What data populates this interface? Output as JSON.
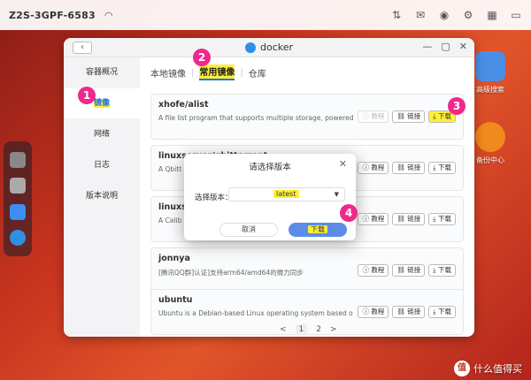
{
  "system": {
    "hostname": "Z2S-3GPF-6583"
  },
  "window": {
    "title": "docker"
  },
  "sidebar": {
    "items": [
      {
        "label": "容器概况"
      },
      {
        "label": "镜像"
      },
      {
        "label": "网络"
      },
      {
        "label": "日志"
      },
      {
        "label": "版本说明"
      }
    ]
  },
  "tabs": [
    {
      "label": "本地镜像"
    },
    {
      "label": "常用镜像"
    },
    {
      "label": "仓库"
    }
  ],
  "images": [
    {
      "name": "xhofe/alist",
      "desc": "A file list program that supports multiple storage, powered by G...",
      "buttons": [
        "教程",
        "链接",
        "下载"
      ]
    },
    {
      "name": "linuxserver/qbittorrent",
      "desc": "A Qbitt",
      "buttons": [
        "教程",
        "链接",
        "下载"
      ]
    },
    {
      "name": "linuxse",
      "desc": "A Calib",
      "buttons": [
        "教程",
        "链接",
        "下载"
      ]
    },
    {
      "name": "jonnya",
      "desc": "[腾讯QQ群]认证]支持arm64/amd64的微力同步",
      "buttons": [
        "教程",
        "链接",
        "下载"
      ]
    },
    {
      "name": "ubuntu",
      "desc": "Ubuntu is a Debian-based Linux operating system based on free...",
      "buttons": [
        "教程",
        "链接",
        "下载"
      ]
    }
  ],
  "pagination": {
    "prev": "<",
    "pages": [
      "1",
      "2"
    ],
    "next": ">"
  },
  "dialog": {
    "title": "请选择版本",
    "label": "选择版本：",
    "value": "latest",
    "cancel": "取消",
    "ok": "下载"
  },
  "desktop": [
    {
      "label": "高级搜索"
    },
    {
      "label": "备份中心"
    }
  ],
  "markers": [
    "1",
    "2",
    "3",
    "4"
  ],
  "watermark": {
    "text": "什么值得买",
    "logo": "值"
  },
  "colors": {
    "accent": "#1a73e8",
    "highlight": "#ffef3a",
    "marker": "#f0288c"
  }
}
